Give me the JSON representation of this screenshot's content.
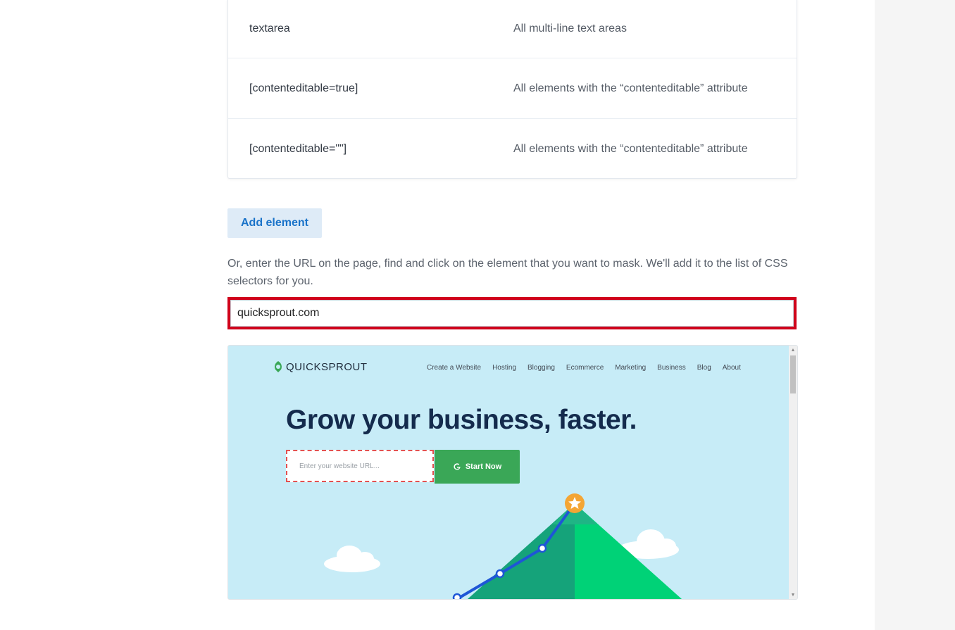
{
  "selectors_table": {
    "rows": [
      {
        "selector": "textarea",
        "description": "All multi-line text areas"
      },
      {
        "selector": "[contenteditable=true]",
        "description": "All elements with the “contenteditable” attribute"
      },
      {
        "selector": "[contenteditable=\"\"]",
        "description": "All elements with the “contenteditable” attribute"
      }
    ]
  },
  "add_element_label": "Add element",
  "hint_text": "Or, enter the URL on the page, find and click on the element that you want to mask. We'll add it to the list of CSS selectors for you.",
  "url_input": {
    "value": "quicksprout.com",
    "placeholder": ""
  },
  "preview": {
    "logo_text": "QUICKSPROUT",
    "nav": [
      "Create a Website",
      "Hosting",
      "Blogging",
      "Ecommerce",
      "Marketing",
      "Business",
      "Blog",
      "About"
    ],
    "headline": "Grow your business, faster.",
    "url_placeholder": "Enter your website URL...",
    "start_button": "Start Now",
    "colors": {
      "background": "#c7ecf7",
      "headline": "#142b4d",
      "button": "#3aa757",
      "highlight": "#d0021b"
    }
  }
}
